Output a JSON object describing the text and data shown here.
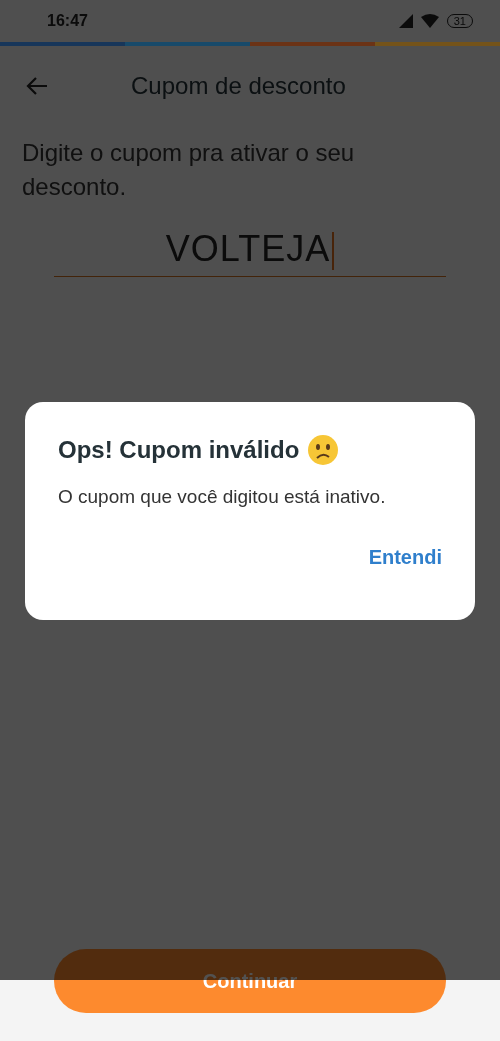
{
  "status_bar": {
    "time": "16:47",
    "battery": "31"
  },
  "progress_segments": [
    {
      "color": "#17365a"
    },
    {
      "color": "#184a6a"
    },
    {
      "color": "#6b3316"
    },
    {
      "color": "#74531a"
    }
  ],
  "header": {
    "title": "Cupom de desconto"
  },
  "instructions": "Digite o cupom pra ativar o seu desconto.",
  "coupon_field": {
    "value": "VOLTEJA"
  },
  "dialog": {
    "title": "Ops! Cupom inválido",
    "message": "O cupom que você digitou está inativo.",
    "action": "Entendi"
  },
  "primary_button": {
    "label": "Continuar"
  }
}
